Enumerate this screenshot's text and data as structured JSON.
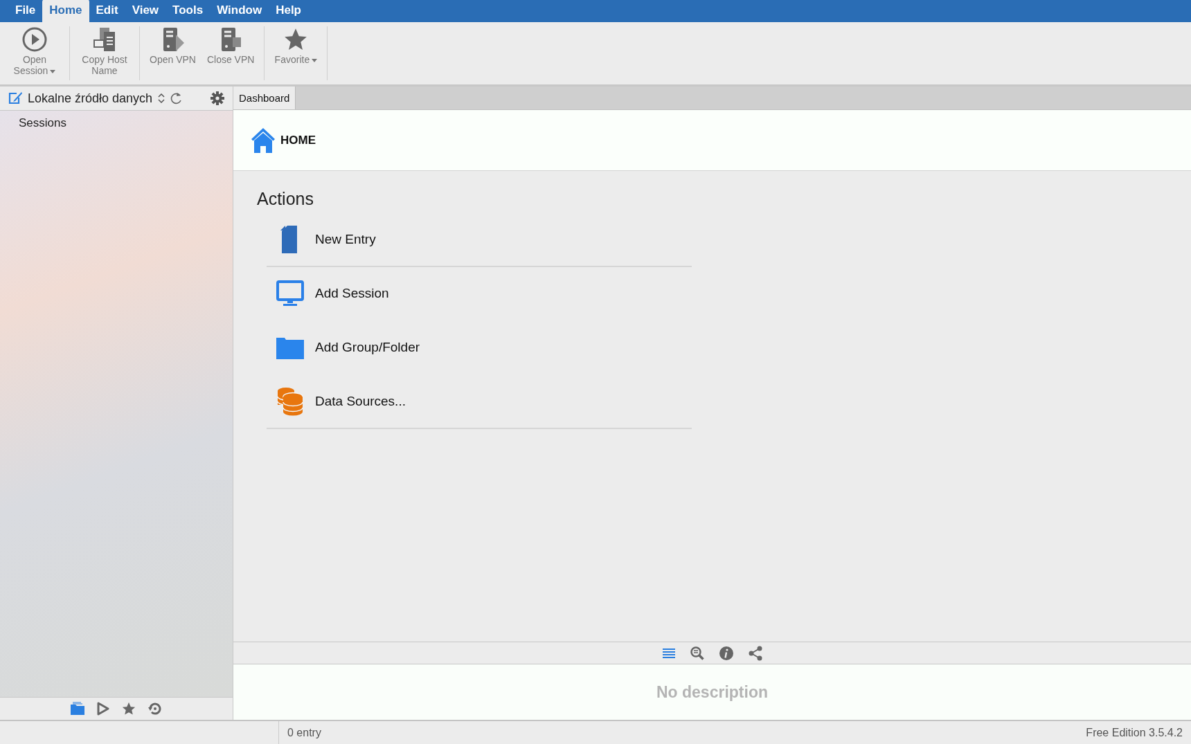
{
  "menu": [
    {
      "label": "File",
      "selected": false
    },
    {
      "label": "Home",
      "selected": true
    },
    {
      "label": "Edit",
      "selected": false
    },
    {
      "label": "View",
      "selected": false
    },
    {
      "label": "Tools",
      "selected": false
    },
    {
      "label": "Window",
      "selected": false
    },
    {
      "label": "Help",
      "selected": false
    }
  ],
  "ribbon": [
    {
      "kind": "play",
      "label": "Open Session",
      "dropdown": true
    },
    {
      "kind": "copy",
      "label": "Copy Host Name",
      "dropdown": false
    },
    {
      "kind": "vpn-open",
      "label": "Open VPN",
      "dropdown": false
    },
    {
      "kind": "vpn-close",
      "label": "Close VPN",
      "dropdown": false
    },
    {
      "kind": "star",
      "label": "Favorite",
      "dropdown": true
    }
  ],
  "sidebar": {
    "source": "Lokalne źródło danych",
    "items": [
      {
        "label": "Sessions"
      }
    ],
    "tools": [
      {
        "kind": "folder",
        "selected": true
      },
      {
        "kind": "play",
        "selected": false
      },
      {
        "kind": "star",
        "selected": false
      },
      {
        "kind": "history",
        "selected": false
      }
    ]
  },
  "tabs": [
    {
      "label": "Dashboard",
      "selected": true
    }
  ],
  "dashboard": {
    "title": "HOME",
    "section": "Actions",
    "actions": [
      {
        "kind": "entry",
        "label": "New Entry",
        "divider": true
      },
      {
        "kind": "session",
        "label": "Add Session",
        "divider": false
      },
      {
        "kind": "folder",
        "label": "Add Group/Folder",
        "divider": false
      },
      {
        "kind": "datasource",
        "label": "Data Sources...",
        "divider": true
      }
    ]
  },
  "details": {
    "tools": [
      {
        "kind": "list",
        "selected": true
      },
      {
        "kind": "search",
        "selected": false
      },
      {
        "kind": "info",
        "selected": false
      },
      {
        "kind": "share",
        "selected": false
      }
    ],
    "description": "No description"
  },
  "status_bar": {
    "count": "0 entry",
    "edition": "Free Edition 3.5.4.2"
  }
}
